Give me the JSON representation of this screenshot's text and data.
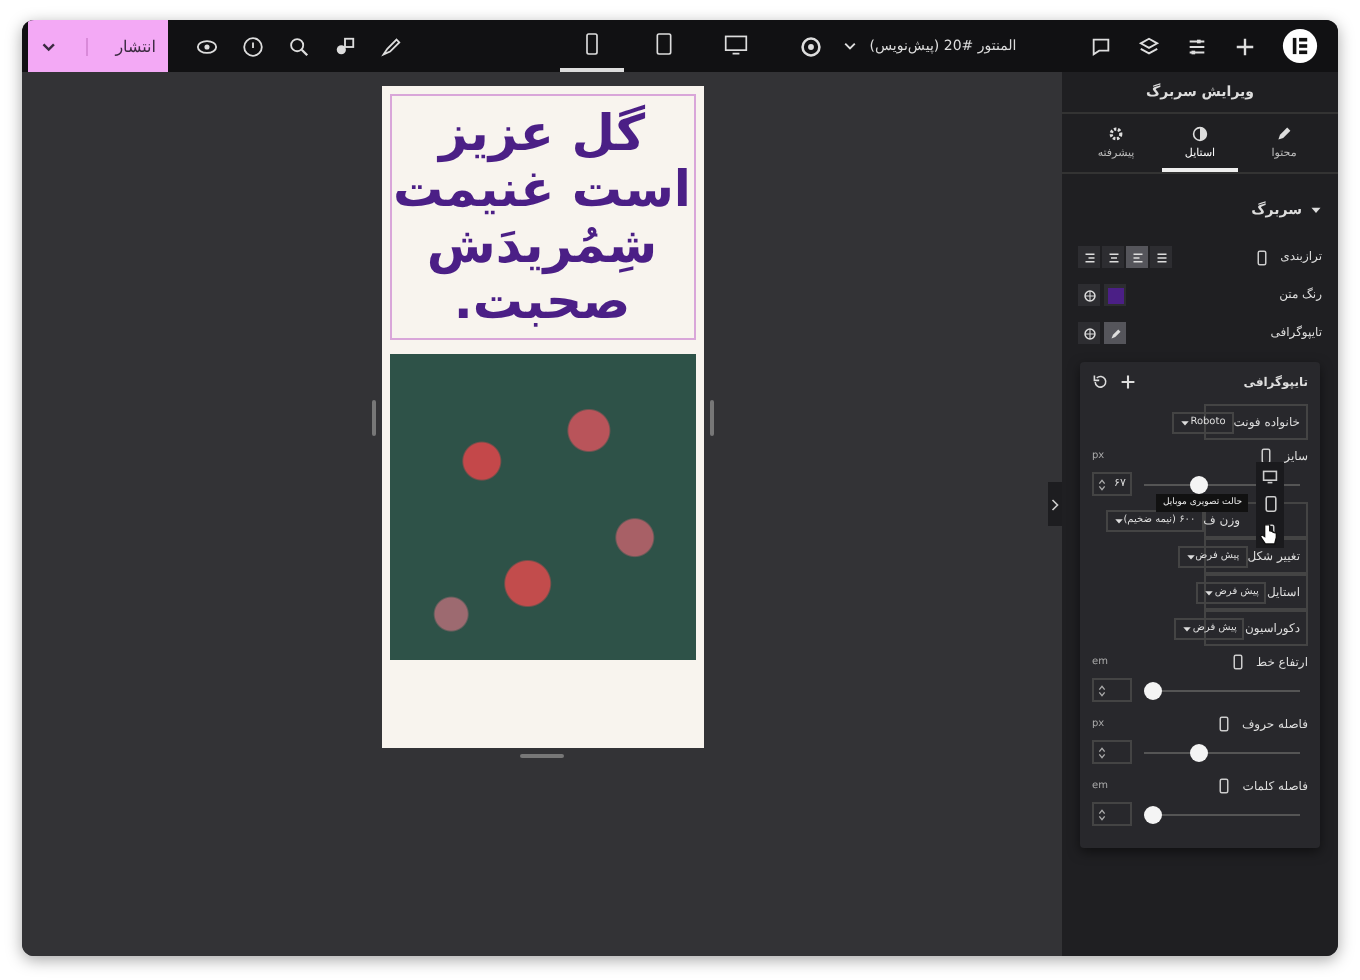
{
  "topbar": {
    "publish": "انتشار",
    "devices": [
      {
        "kind": "mobile",
        "selected": true
      },
      {
        "kind": "tablet",
        "selected": false
      },
      {
        "kind": "desktop",
        "selected": false
      }
    ],
    "document_title": "المنتور #20 (پیش‌نویس)"
  },
  "canvas": {
    "heading": "گل عزیز است غنیمت شِمُریدَش صحبت."
  },
  "panel": {
    "title": "ویرایش سربرگ",
    "tabs": [
      {
        "kind": "content",
        "label": "محتوا",
        "selected": false
      },
      {
        "kind": "style",
        "label": "استایل",
        "selected": true
      },
      {
        "kind": "advanced",
        "label": "پیشرفته",
        "selected": false
      }
    ],
    "section": {
      "title": "سربرگ",
      "expanded": true
    },
    "controls": [
      {
        "kind": "align",
        "label": "ترازبندی",
        "options": [
          {
            "kind": "right",
            "selected": false
          },
          {
            "kind": "center",
            "selected": false
          },
          {
            "kind": "left",
            "selected": true
          },
          {
            "kind": "justify",
            "selected": false
          }
        ]
      },
      {
        "kind": "color",
        "label": "رنگ متن",
        "color": "#4b1f86"
      },
      {
        "kind": "typography",
        "label": "تایپوگرافی",
        "active": true
      }
    ],
    "popover": {
      "title": "تایپوگرافی",
      "rows": [
        {
          "kind": "select",
          "label": "خانواده فونت",
          "value": "Roboto"
        },
        {
          "kind": "slider",
          "label": "سایز",
          "unit": "px",
          "value": "۶۷",
          "level": 0.33,
          "devices_open": true,
          "tooltip": "حالت تصویری موبایل"
        },
        {
          "kind": "select",
          "label": "وزن ف",
          "value": "۶۰۰ (نیمه ضخیم)"
        },
        {
          "kind": "select",
          "label": "تغییر شکل",
          "value": "پیش فرض"
        },
        {
          "kind": "select",
          "label": "استایل",
          "value": "پیش فرض"
        },
        {
          "kind": "select",
          "label": "دکوراسیون",
          "value": "پیش فرض"
        },
        {
          "kind": "slider",
          "label": "ارتفاع خط",
          "unit": "em",
          "level": 0
        },
        {
          "kind": "slider",
          "label": "فاصله حروف",
          "unit": "px",
          "level": 0.33
        },
        {
          "kind": "slider",
          "label": "فاصله کلمات",
          "unit": "em",
          "level": 0
        }
      ]
    }
  }
}
